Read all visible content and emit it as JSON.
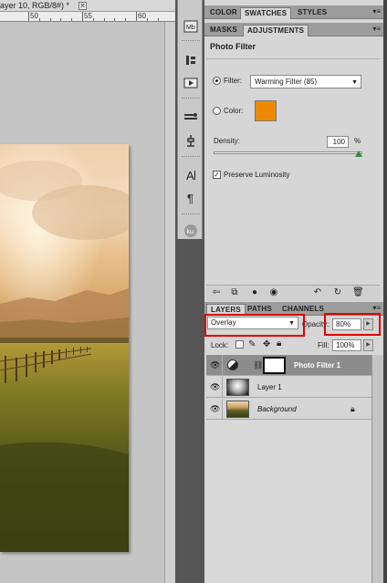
{
  "document": {
    "tab_title": "ayer 10, RGB/8#) *",
    "close_glyph": "✕",
    "ruler_labels": [
      "50",
      "55",
      "60"
    ]
  },
  "tool_strip": {
    "icons": [
      "mini-bridge-icon",
      "history-icon",
      "actions-icon",
      "brushes-icon",
      "clone-source-icon",
      "character-icon",
      "paragraph-icon",
      "kuler-icon"
    ]
  },
  "top_panel": {
    "tabs": [
      "COLOR",
      "SWATCHES",
      "STYLES"
    ],
    "active_tab": "SWATCHES",
    "menu_glyph": "▾≡"
  },
  "adjust_panel": {
    "tabs": [
      "MASKS",
      "ADJUSTMENTS"
    ],
    "active_tab": "ADJUSTMENTS",
    "title": "Photo Filter",
    "filter_label": "Filter:",
    "filter_value": "Warming Filter (85)",
    "filter_selected": true,
    "color_label": "Color:",
    "color_value": "#EC8A00",
    "density_label": "Density:",
    "density_value": "100",
    "density_unit": "%",
    "density_fraction": 1.0,
    "preserve_label": "Preserve Luminosity",
    "preserve_checked": true
  },
  "layers_panel": {
    "tabs": [
      "LAYERS",
      "PATHS",
      "CHANNELS"
    ],
    "active_tab": "LAYERS",
    "blend_mode": "Overlay",
    "opacity_label": "Opacity:",
    "opacity_value": "80%",
    "lock_label": "Lock:",
    "fill_label": "Fill:",
    "fill_value": "100%",
    "layers": [
      {
        "name": "Photo Filter 1",
        "selected": true,
        "visible": true
      },
      {
        "name": "Layer 1",
        "selected": false,
        "visible": true
      },
      {
        "name": "Background",
        "selected": false,
        "visible": true,
        "locked": true
      }
    ]
  },
  "colors": {
    "highlight_box": "#E00000",
    "swatch": "#EC8A00",
    "selected_row": "#8D8D8D"
  }
}
